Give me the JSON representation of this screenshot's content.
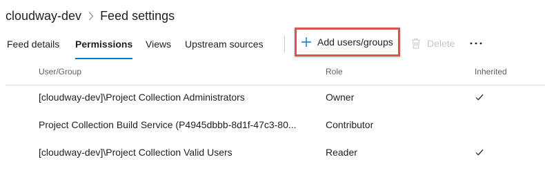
{
  "breadcrumb": {
    "project": "cloudway-dev",
    "separator_icon": "chevron-right-icon",
    "page": "Feed settings"
  },
  "tabs": [
    {
      "label": "Feed details",
      "active": false
    },
    {
      "label": "Permissions",
      "active": true
    },
    {
      "label": "Views",
      "active": false
    },
    {
      "label": "Upstream sources",
      "active": false
    }
  ],
  "toolbar": {
    "add_label": "Add users/groups",
    "add_icon": "plus-icon",
    "delete_label": "Delete",
    "delete_icon": "trash-icon",
    "delete_enabled": false,
    "more_icon": "more-icon"
  },
  "table": {
    "columns": [
      "User/Group",
      "Role",
      "Inherited"
    ],
    "rows": [
      {
        "user": "[cloudway-dev]\\Project Collection Administrators",
        "role": "Owner",
        "inherited": true
      },
      {
        "user": "Project Collection Build Service (P4945dbbb-8d1f-47c3-80...",
        "role": "Contributor",
        "inherited": false
      },
      {
        "user": "[cloudway-dev]\\Project Collection Valid Users",
        "role": "Reader",
        "inherited": true
      }
    ]
  },
  "colors": {
    "accent": "#0078d4",
    "highlight_border": "#d9534f",
    "disabled_text": "#c8c6c4"
  }
}
